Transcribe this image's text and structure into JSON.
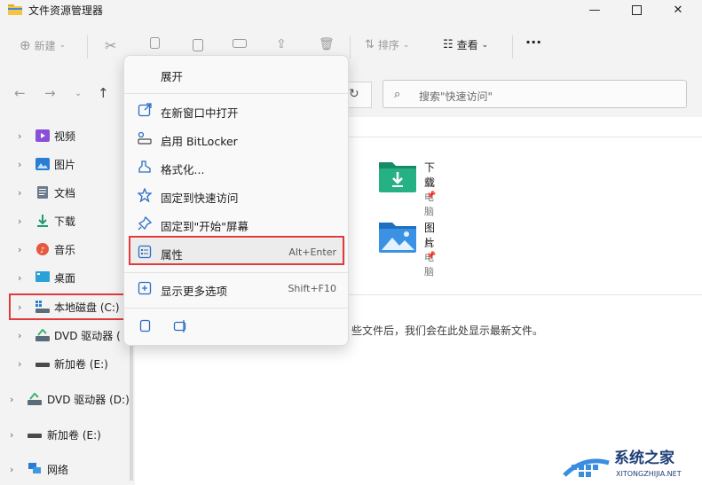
{
  "window": {
    "title": "文件资源管理器"
  },
  "toolbar": {
    "new_label": "新建",
    "sort_label": "排序",
    "view_label": "查看",
    "more_label": "···"
  },
  "search": {
    "placeholder": "搜索\"快速访问\""
  },
  "sidebar": {
    "items": [
      {
        "label": "视频"
      },
      {
        "label": "图片"
      },
      {
        "label": "文档"
      },
      {
        "label": "下载"
      },
      {
        "label": "音乐"
      },
      {
        "label": "桌面"
      },
      {
        "label": "本地磁盘 (C:)"
      },
      {
        "label": "DVD 驱动器 ("
      },
      {
        "label": "新加卷 (E:)"
      },
      {
        "label": "DVD 驱动器 (D:)"
      },
      {
        "label": "新加卷 (E:)"
      },
      {
        "label": "网络"
      }
    ]
  },
  "quick_access": [
    {
      "name": "下载",
      "sub": "此电脑"
    },
    {
      "name": "图片",
      "sub": "此电脑"
    }
  ],
  "recent": {
    "message": "些文件后，我们会在此处显示最新文件。"
  },
  "context_menu": {
    "expand": "展开",
    "open_new_window": "在新窗口中打开",
    "bitlocker": "启用 BitLocker",
    "format": "格式化...",
    "pin_quick": "固定到快速访问",
    "pin_start": "固定到\"开始\"屏幕",
    "properties": "属性",
    "properties_shortcut": "Alt+Enter",
    "more_options": "显示更多选项",
    "more_options_shortcut": "Shift+F10"
  },
  "watermark": {
    "brand": "系统之家",
    "url": "XITONGZHIJIA.NET"
  },
  "colors": {
    "highlight": "#e03b3b",
    "folder_green": "#1f9b74",
    "folder_blue": "#2b7cd3"
  }
}
